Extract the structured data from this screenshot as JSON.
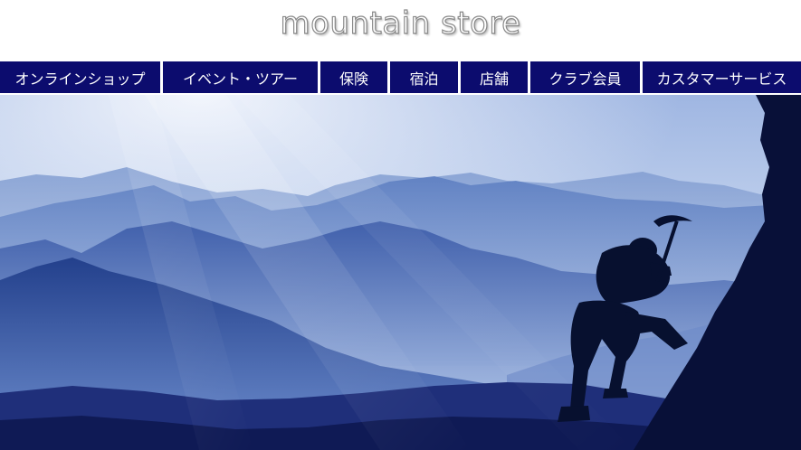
{
  "site": {
    "logo_text": "mountain store"
  },
  "nav": {
    "items": [
      {
        "label": "オンラインショップ"
      },
      {
        "label": "イベント・ツアー"
      },
      {
        "label": "保険"
      },
      {
        "label": "宿泊"
      },
      {
        "label": "店舗"
      },
      {
        "label": "クラブ会員"
      },
      {
        "label": "カスタマーサービス"
      }
    ]
  },
  "colors": {
    "nav_background": "#0c0c6e",
    "nav_text": "#ffffff",
    "sky_top": "#9db3df",
    "sky_glow": "#e8eef9",
    "mountain_dark": "#0b1240"
  },
  "hero": {
    "image_description_icon": "mountain-climber-silhouette-image"
  }
}
